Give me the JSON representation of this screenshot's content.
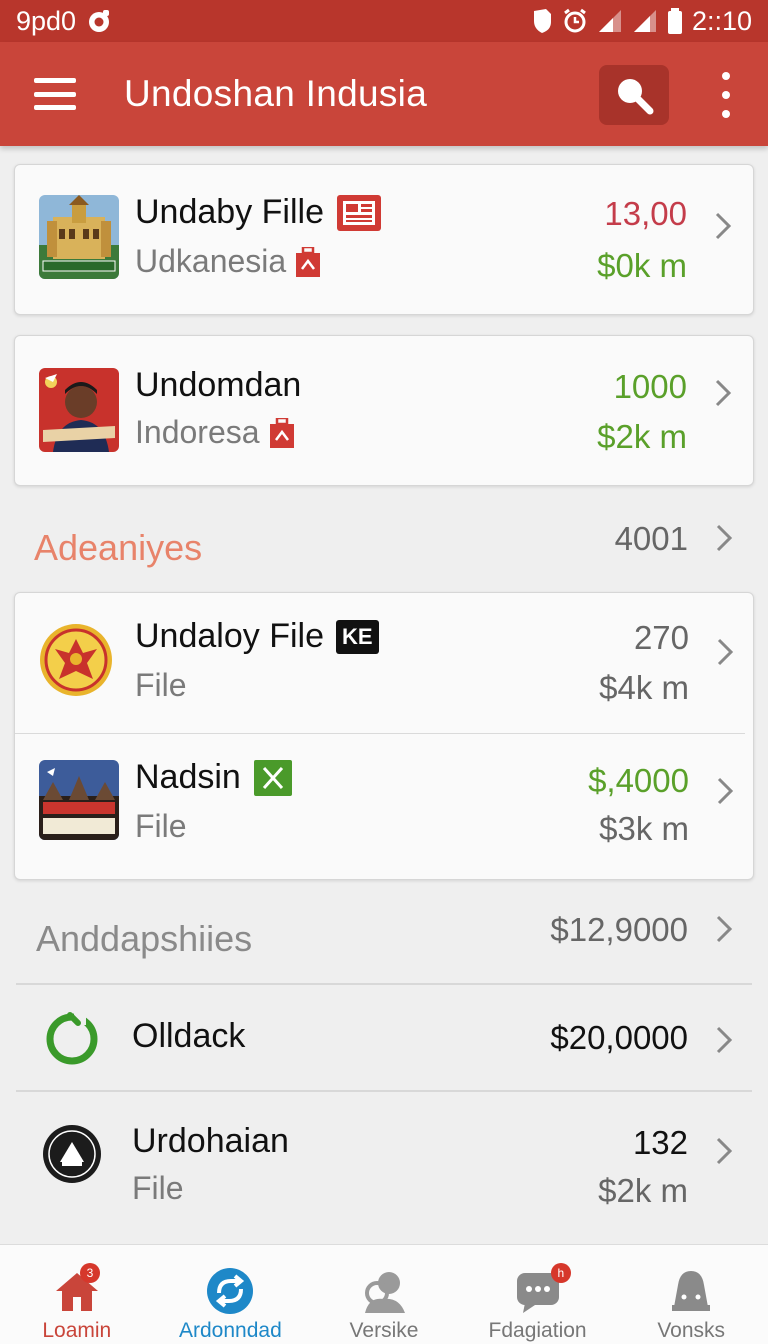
{
  "status_bar": {
    "left_text": "9pd0",
    "time": "2::10"
  },
  "app_bar": {
    "title": "Undoshan Indusia"
  },
  "top_items": [
    {
      "name": "Undaby Fille",
      "subtitle": "Udkanesia",
      "value": "13,00",
      "value_color": "#c43c4a",
      "amount": "$0k m",
      "amount_color": "#5aa02a"
    },
    {
      "name": "Undomdan",
      "subtitle": "Indoresa",
      "value": "1000",
      "value_color": "#5aa02a",
      "amount": "$2k m",
      "amount_color": "#5aa02a"
    }
  ],
  "section1": {
    "title": "Adeaniyes",
    "title_color": "#e8836a",
    "count": "4001",
    "items": [
      {
        "name": "Undaloy File",
        "tag": "KE",
        "subtitle": "File",
        "value": "270",
        "value_color": "#666666",
        "amount": "$4k m"
      },
      {
        "name": "Nadsin",
        "subtitle": "File",
        "value": "$,4000",
        "value_color": "#5aa02a",
        "amount": "$3k m"
      }
    ]
  },
  "section2": {
    "title": "Anddapshiies",
    "title_color": "#8a8a8a",
    "count": "$12,9000",
    "items": [
      {
        "name": "Olldack",
        "value": "$20,0000"
      },
      {
        "name": "Urdohaian",
        "subtitle": "File",
        "value": "132",
        "amount": "$2k m"
      }
    ]
  },
  "bottom_nav": [
    {
      "label": "Loamin",
      "color": "#c9453a",
      "icon": "home-icon",
      "badge": "3"
    },
    {
      "label": "Ardonndad",
      "color": "#1e88c8",
      "icon": "sync-icon"
    },
    {
      "label": "Versike",
      "color": "#888888",
      "icon": "people-icon"
    },
    {
      "label": "Fdagiation",
      "color": "#888888",
      "icon": "chat-icon",
      "badge": "h"
    },
    {
      "label": "Vonsks",
      "color": "#888888",
      "icon": "bell-icon"
    }
  ],
  "colors": {
    "primary": "#c9453a",
    "status_bar": "#b8362c",
    "positive": "#5aa02a",
    "accent_blue": "#1e88c8"
  }
}
